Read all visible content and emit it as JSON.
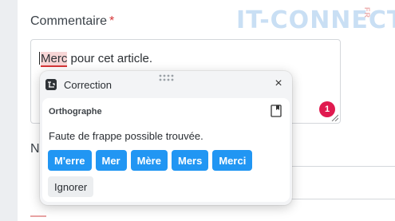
{
  "brand": {
    "watermark_text": "IT-CONNECT",
    "watermark_suffix": "FR"
  },
  "form": {
    "comment_label": "Commentaire",
    "required_mark": "*",
    "comment_misspelled_word": "Merc",
    "comment_rest": " pour cet article.",
    "next_label_partial": "N"
  },
  "error_badge": {
    "count": "1",
    "color": "#e01a4f"
  },
  "popup": {
    "title": "Correction",
    "section_title": "Orthographe",
    "message": "Faute de frappe possible trouvée.",
    "suggestions": [
      "M'erre",
      "Mer",
      "Mère",
      "Mers",
      "Merci"
    ],
    "ignore_label": "Ignorer",
    "icons": {
      "logo": "app-logo-icon",
      "drag": "drag-handle-icon",
      "close": "close-icon",
      "dictionary": "dictionary-icon"
    }
  },
  "colors": {
    "accent": "#2196f3",
    "error": "#d63638",
    "popup_bg": "#f3f4f6"
  }
}
